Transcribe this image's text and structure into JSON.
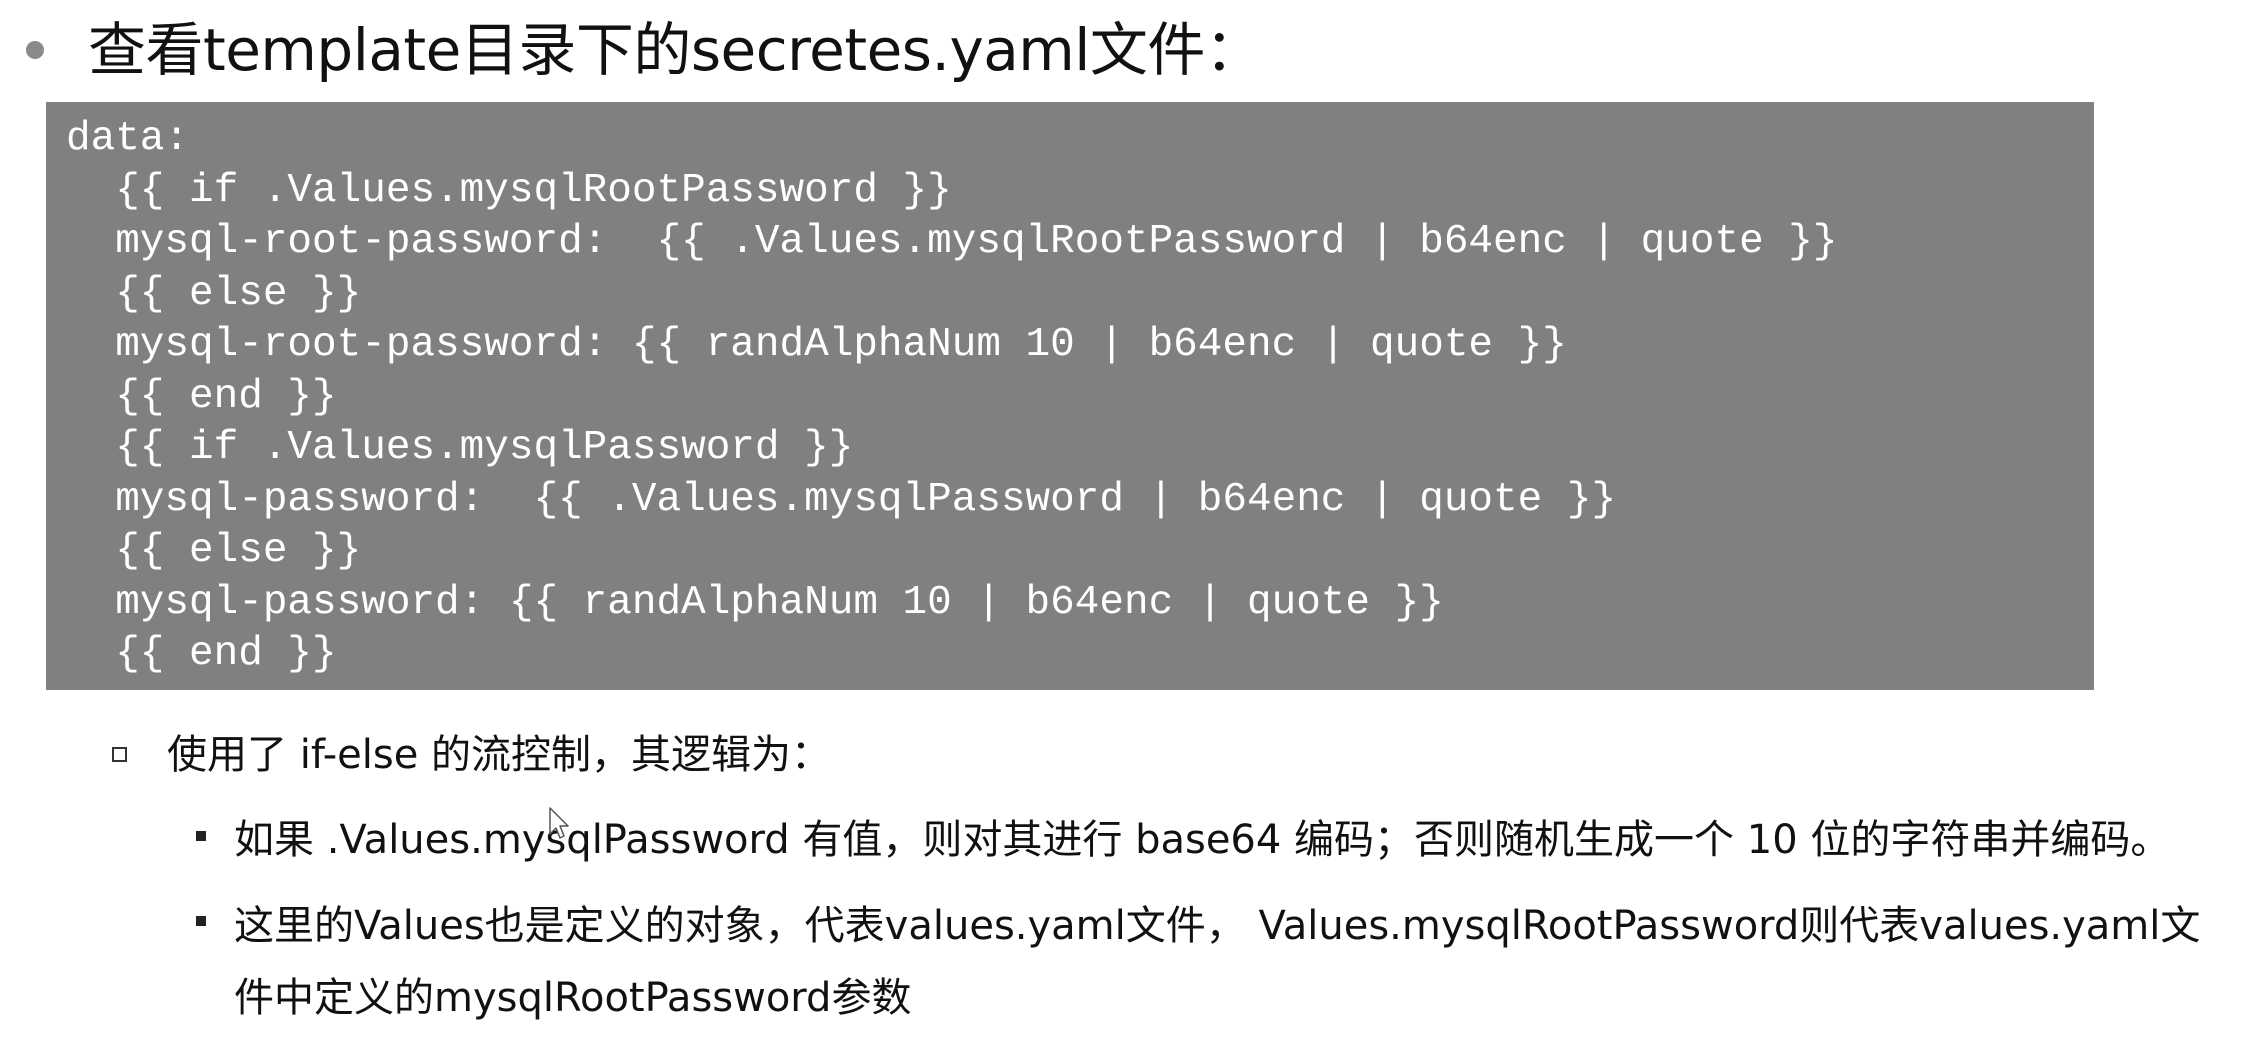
{
  "heading": "查看template目录下的secretes.yaml文件：",
  "code_lines": [
    "data:",
    "  {{ if .Values.mysqlRootPassword }}",
    "  mysql-root-password:  {{ .Values.mysqlRootPassword | b64enc | quote }}",
    "  {{ else }}",
    "  mysql-root-password: {{ randAlphaNum 10 | b64enc | quote }}",
    "  {{ end }}",
    "  {{ if .Values.mysqlPassword }}",
    "  mysql-password:  {{ .Values.mysqlPassword | b64enc | quote }}",
    "  {{ else }}",
    "  mysql-password: {{ randAlphaNum 10 | b64enc | quote }}",
    "  {{ end }}"
  ],
  "subpoint": "使用了 if-else 的流控制，其逻辑为：",
  "list_items": [
    "如果 .Values.mysqlPassword 有值，则对其进行 base64 编码；否则随机生成一个 10 位的字符串并编码。",
    "这里的Values也是定义的对象，代表values.yaml文件， Values.mysqlRootPassword则代表values.yaml文件中定义的mysqlRootPassword参数"
  ],
  "colors": {
    "code_background": "#808080",
    "code_text": "#ffffff",
    "bullet_dot": "#8a8a8a"
  },
  "icons": {
    "cursor": "mouse-pointer-icon"
  }
}
